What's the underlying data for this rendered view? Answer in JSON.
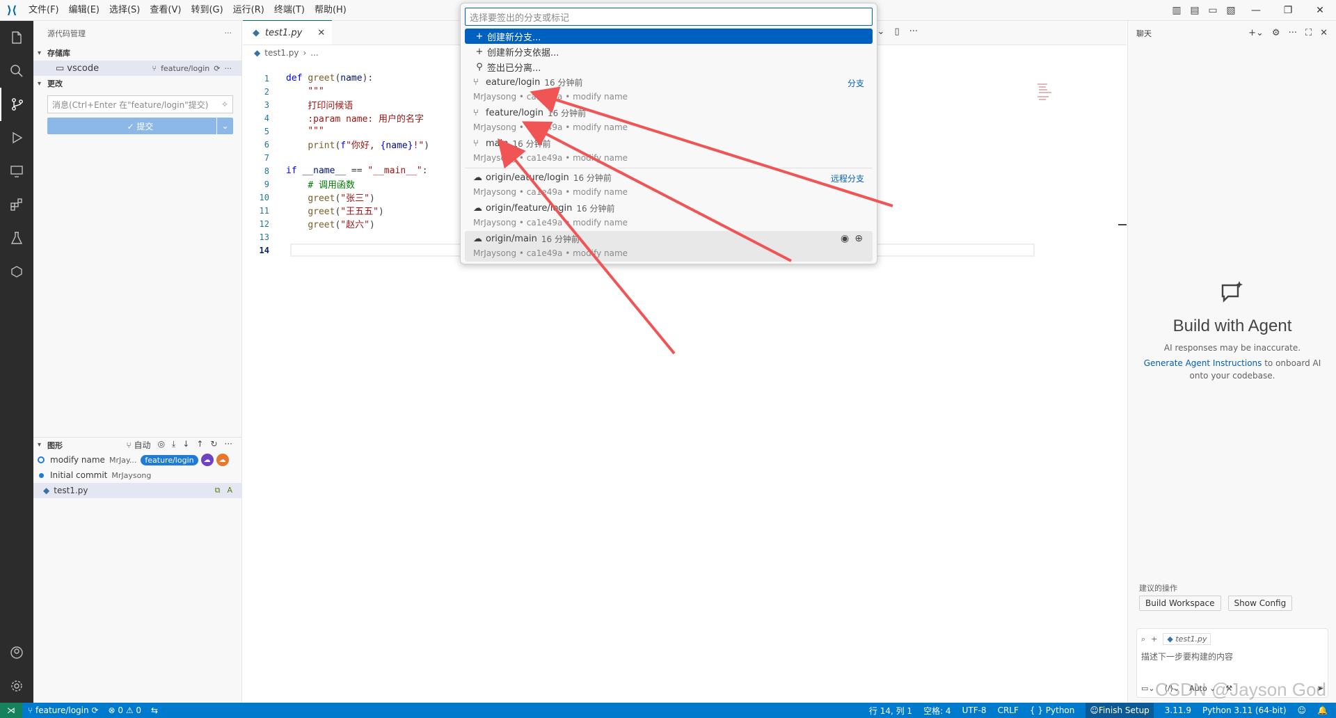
{
  "titlebar": {
    "menus": [
      "文件(F)",
      "编辑(E)",
      "选择(S)",
      "查看(V)",
      "转到(G)",
      "运行(R)",
      "终端(T)",
      "帮助(H)"
    ]
  },
  "sidebar": {
    "title": "源代码管理",
    "repos_label": "存储库",
    "repo_name": "vscode",
    "repo_branch": "feature/login",
    "changes_label": "更改",
    "commit_placeholder": "消息(Ctrl+Enter 在\"feature/login\"提交)",
    "commit_button": "✓ 提交",
    "graph_label": "图形",
    "graph_auto": "自动",
    "graph_rows": [
      {
        "message": "modify name",
        "author": "MrJay...",
        "badge": "feature/login"
      },
      {
        "message": "Initial commit",
        "author": "MrJaysong"
      }
    ],
    "file_name": "test1.py",
    "file_status": "A"
  },
  "editor": {
    "tab_label": "test1.py",
    "breadcrumb_file": "test1.py",
    "breadcrumb_more": "...",
    "lines": [
      {
        "n": "1",
        "html": "<span class='kw'>def</span> <span class='fn'>greet</span>(<span class='var'>name</span>):"
      },
      {
        "n": "2",
        "html": "    <span class='str'>\"\"\"</span>"
      },
      {
        "n": "3",
        "html": "    <span class='str'>打印问候语</span>"
      },
      {
        "n": "4",
        "html": "    <span class='str'>:param name: 用户的名字</span>"
      },
      {
        "n": "5",
        "html": "    <span class='str'>\"\"\"</span>"
      },
      {
        "n": "6",
        "html": "    <span class='fn'>print</span>(<span class='kw'>f</span><span class='str'>\"你好, </span><span class='kw'>{</span><span class='var'>name</span><span class='kw'>}</span><span class='str'>!\"</span>)"
      },
      {
        "n": "7",
        "html": ""
      },
      {
        "n": "8",
        "html": "<span class='kw'>if</span> <span class='var'>__name__</span> == <span class='str'>\"__main__\"</span>:"
      },
      {
        "n": "9",
        "html": "    <span class='cm'># 调用函数</span>"
      },
      {
        "n": "10",
        "html": "    <span class='fn'>greet</span>(<span class='str'>\"张三\"</span>)"
      },
      {
        "n": "11",
        "html": "    <span class='fn'>greet</span>(<span class='str'>\"王五五\"</span>)"
      },
      {
        "n": "12",
        "html": "    <span class='fn'>greet</span>(<span class='str'>\"赵六\"</span>)"
      },
      {
        "n": "13",
        "html": ""
      },
      {
        "n": "14",
        "html": ""
      }
    ]
  },
  "quickpick": {
    "placeholder": "选择要签出的分支或标记",
    "actions": [
      "创建新分支...",
      "创建新分支依据...",
      "签出已分离..."
    ],
    "group_local": "分支",
    "group_remote": "远程分支",
    "branches": [
      {
        "name": "eature/login",
        "time": "16 分钟前",
        "detail": "MrJaysong • ca1e49a • modify name"
      },
      {
        "name": "feature/login",
        "time": "16 分钟前",
        "detail": "MrJaysong • ca1e49a • modify name"
      },
      {
        "name": "main",
        "time": "16 分钟前",
        "detail": "MrJaysong • ca1e49a • modify name"
      }
    ],
    "remotes": [
      {
        "name": "origin/eature/login",
        "time": "16 分钟前",
        "detail": "MrJaysong • ca1e49a • modify name"
      },
      {
        "name": "origin/feature/login",
        "time": "16 分钟前",
        "detail": "MrJaysong • ca1e49a • modify name"
      },
      {
        "name": "origin/main",
        "time": "16 分钟前",
        "detail": "MrJaysong • ca1e49a • modify name"
      }
    ]
  },
  "chat": {
    "title": "聊天",
    "agent_title": "Build with Agent",
    "agent_note": "AI responses may be inaccurate.",
    "agent_link": "Generate Agent Instructions",
    "agent_rest": " to onboard AI onto your codebase.",
    "suggest_label": "建议的操作",
    "suggest_buttons": [
      "Build Workspace",
      "Show Config"
    ],
    "attach_file": "test1.py",
    "input_placeholder": "描述下一步要构建的内容",
    "mode": "Auto"
  },
  "statusbar": {
    "branch": "feature/login",
    "problems": "⊗ 0 ⚠ 0",
    "position": "行 14, 列 1",
    "spaces": "空格: 4",
    "encoding": "UTF-8",
    "eol": "CRLF",
    "language": "{ } Python",
    "setup": "Finish Setup",
    "version": "3.11.9",
    "interpreter": "Python 3.11 (64-bit)"
  },
  "watermark": "CSDN @Jayson God",
  "colors": {
    "accent": "#005fb8",
    "statusbar": "#007acc",
    "arrow": "#f05454"
  }
}
